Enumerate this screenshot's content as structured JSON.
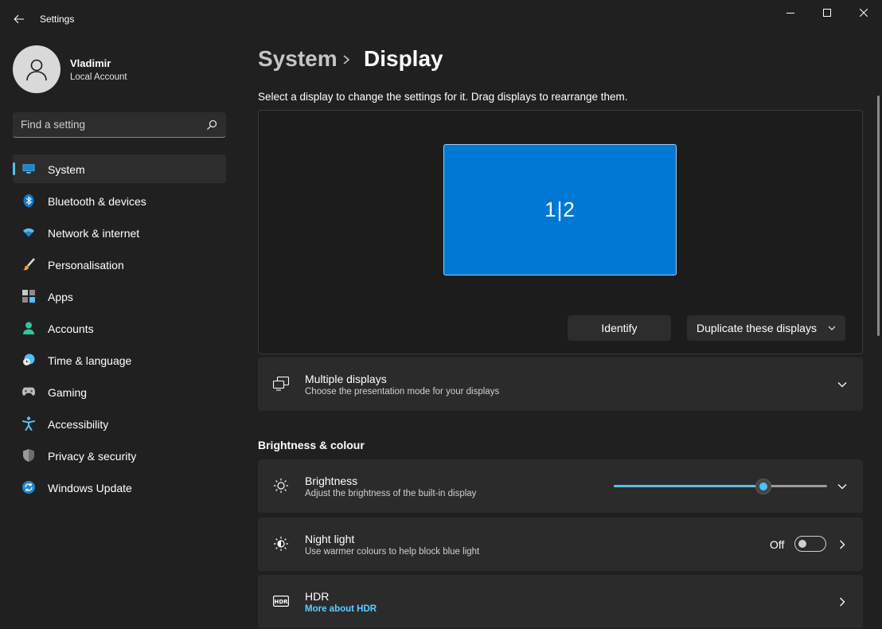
{
  "window": {
    "title": "Settings"
  },
  "user": {
    "name": "Vladimir",
    "account_type": "Local Account"
  },
  "search": {
    "placeholder": "Find a setting"
  },
  "sidebar": {
    "items": [
      {
        "label": "System",
        "icon": "monitor-icon",
        "active": true
      },
      {
        "label": "Bluetooth & devices",
        "icon": "bluetooth-icon"
      },
      {
        "label": "Network & internet",
        "icon": "wifi-icon"
      },
      {
        "label": "Personalisation",
        "icon": "paintbrush-icon"
      },
      {
        "label": "Apps",
        "icon": "apps-icon"
      },
      {
        "label": "Accounts",
        "icon": "person-icon"
      },
      {
        "label": "Time & language",
        "icon": "clock-globe-icon"
      },
      {
        "label": "Gaming",
        "icon": "gamepad-icon"
      },
      {
        "label": "Accessibility",
        "icon": "accessibility-icon"
      },
      {
        "label": "Privacy & security",
        "icon": "shield-icon"
      },
      {
        "label": "Windows Update",
        "icon": "update-icon"
      }
    ]
  },
  "breadcrumb": {
    "parent": "System",
    "current": "Display"
  },
  "display_hint": "Select a display to change the settings for it. Drag displays to rearrange them.",
  "display_panel": {
    "monitor_label": "1|2",
    "identify_label": "Identify",
    "mode_label": "Duplicate these displays"
  },
  "multiple_displays": {
    "title": "Multiple displays",
    "subtitle": "Choose the presentation mode for your displays"
  },
  "brightness_section": {
    "title": "Brightness & colour"
  },
  "brightness": {
    "title": "Brightness",
    "subtitle": "Adjust the brightness of the built-in display",
    "value_percent": 70
  },
  "night_light": {
    "title": "Night light",
    "subtitle": "Use warmer colours to help block blue light",
    "state_label": "Off"
  },
  "hdr": {
    "title": "HDR",
    "link": "More about HDR"
  },
  "colors": {
    "accent": "#4cc2ff",
    "monitor": "#0078d4",
    "background": "#202020",
    "card": "#2b2b2b"
  }
}
